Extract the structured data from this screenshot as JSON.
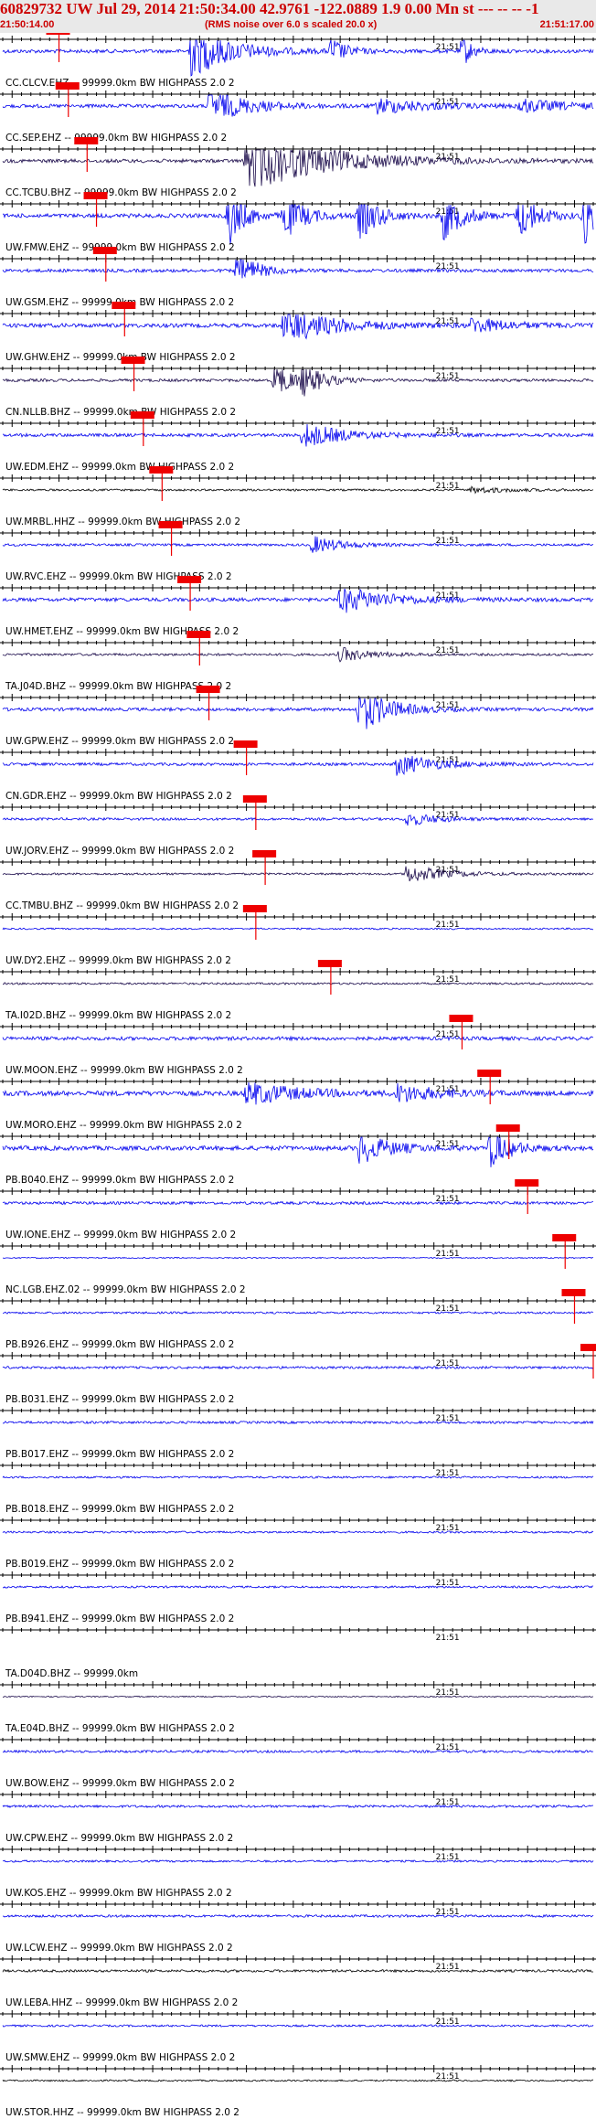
{
  "header": {
    "title": "60829732 UW Jul 29, 2014 21:50:34.00   42.9761 -122.0889  1.9 0.00 Mn st --- -- -- -1",
    "start_time": "21:50:14.00",
    "scale_note": "(RMS noise over 6.0 s scaled 20.0 x)",
    "end_time": "21:51:17.00"
  },
  "chart_data": {
    "type": "seismogram",
    "time_range": [
      "21:50:14.00",
      "21:51:17.00"
    ],
    "minute_mark_label": "21:51",
    "minute_mark_time": "21:51:00",
    "colors": {
      "trace_blue": "#0000ee",
      "trace_dark": "#1a0a4a",
      "trace_black": "#000000",
      "pick": "#ee0000",
      "text": "#000000"
    },
    "traces": [
      {
        "label": "CC.CLCV.EHZ -- 99999.0km BW  HIGHPASS  2.0  2",
        "color": "blue",
        "amp": 0.9,
        "pick": "21:50:20",
        "bursts": [
          [
            20,
            4,
            2.5
          ],
          [
            35,
            1.5,
            1.2
          ],
          [
            49,
            1,
            1.5
          ]
        ]
      },
      {
        "label": "CC.SEP.EHZ -- 99999.0km BW  HIGHPASS  2.0  2",
        "color": "blue",
        "amp": 0.9,
        "pick": "21:50:21",
        "bursts": [
          [
            22,
            4,
            1.5
          ],
          [
            40,
            5,
            0.7
          ],
          [
            55,
            5,
            0.6
          ]
        ]
      },
      {
        "label": "CC.TCBU.BHZ -- 99999.0km BW  HIGHPASS  2.0  2",
        "color": "dark",
        "amp": 0.9,
        "pick": "21:50:23",
        "bursts": [
          [
            26,
            8,
            2.8
          ]
        ]
      },
      {
        "label": "UW.FMW.EHZ -- 99999.0km BW  HIGHPASS  2.0  2",
        "color": "blue",
        "amp": 1.0,
        "pick": "21:50:24",
        "bursts": [
          [
            24,
            1.5,
            3
          ],
          [
            30,
            2,
            2
          ],
          [
            38,
            2,
            2
          ],
          [
            47,
            2,
            2
          ],
          [
            55,
            2,
            2
          ],
          [
            62,
            1.5,
            2.5
          ]
        ]
      },
      {
        "label": "UW.GSM.EHZ -- 99999.0km BW  HIGHPASS  2.0  2",
        "color": "blue",
        "amp": 0.8,
        "pick": "21:50:25",
        "bursts": [
          [
            25,
            2,
            2
          ]
        ]
      },
      {
        "label": "UW.GHW.EHZ -- 99999.0km BW  HIGHPASS  2.0  2",
        "color": "blue",
        "amp": 1.0,
        "pick": "21:50:27",
        "bursts": [
          [
            30,
            5,
            1.5
          ],
          [
            50,
            4,
            0.6
          ]
        ]
      },
      {
        "label": "CN.NLLB.BHZ -- 99999.0km BW  HIGHPASS  2.0  2",
        "color": "dark",
        "amp": 0.7,
        "pick": "21:50:28",
        "bursts": [
          [
            29,
            2,
            2.2
          ],
          [
            32,
            2,
            1.8
          ]
        ]
      },
      {
        "label": "UW.EDM.EHZ -- 99999.0km BW  HIGHPASS  2.0  2",
        "color": "blue",
        "amp": 0.8,
        "pick": "21:50:29",
        "bursts": [
          [
            32,
            4,
            1.3
          ]
        ]
      },
      {
        "label": "UW.MRBL.HHZ -- 99999.0km BW  HIGHPASS  2.0  2",
        "color": "black",
        "amp": 0.5,
        "pick": "21:50:31",
        "bursts": [
          [
            50,
            4,
            0.5
          ]
        ]
      },
      {
        "label": "UW.RVC.EHZ -- 99999.0km BW  HIGHPASS  2.0  2",
        "color": "blue",
        "amp": 0.6,
        "pick": "21:50:32",
        "bursts": [
          [
            33,
            3,
            1.2
          ]
        ]
      },
      {
        "label": "UW.HMET.EHZ -- 99999.0km BW  HIGHPASS  2.0  2",
        "color": "blue",
        "amp": 0.9,
        "pick": "21:50:34",
        "bursts": [
          [
            36,
            5,
            1.2
          ]
        ]
      },
      {
        "label": "TA.J04D.BHZ -- 99999.0km BW  HIGHPASS  2.0  2",
        "color": "dark",
        "amp": 0.6,
        "pick": "21:50:35",
        "bursts": [
          [
            36,
            3,
            1.0
          ]
        ]
      },
      {
        "label": "UW.GPW.EHZ -- 99999.0km BW  HIGHPASS  2.0  2",
        "color": "blue",
        "amp": 0.8,
        "pick": "21:50:36",
        "bursts": [
          [
            38,
            3,
            2.5
          ]
        ]
      },
      {
        "label": "CN.GDR.EHZ -- 99999.0km BW  HIGHPASS  2.0  2",
        "color": "blue",
        "amp": 0.7,
        "pick": "21:50:40",
        "bursts": [
          [
            42,
            4,
            1.3
          ]
        ]
      },
      {
        "label": "UW.JORV.EHZ -- 99999.0km BW  HIGHPASS  2.0  2",
        "color": "blue",
        "amp": 0.6,
        "pick": "21:50:41",
        "bursts": [
          [
            43,
            3,
            1.0
          ]
        ]
      },
      {
        "label": "CC.TMBU.BHZ -- 99999.0km BW  HIGHPASS  2.0  2",
        "color": "dark",
        "amp": 0.5,
        "pick": "21:50:42",
        "bursts": [
          [
            43,
            4,
            1.5
          ]
        ]
      },
      {
        "label": "UW.DY2.EHZ -- 99999.0km BW  HIGHPASS  2.0  2",
        "color": "blue",
        "amp": 0.4,
        "pick": "21:50:41",
        "bursts": []
      },
      {
        "label": "TA.I02D.BHZ -- 99999.0km BW  HIGHPASS  2.0  2",
        "color": "dark",
        "amp": 0.5,
        "pick": "21:50:49",
        "bursts": []
      },
      {
        "label": "UW.MOON.EHZ -- 99999.0km BW  HIGHPASS  2.0  2",
        "color": "blue",
        "amp": 0.9,
        "pick": "21:51:03",
        "bursts": [
          [
            75,
            4,
            1.2
          ]
        ]
      },
      {
        "label": "UW.MORO.EHZ -- 99999.0km BW  HIGHPASS  2.0  2",
        "color": "blue",
        "amp": 1.2,
        "pick": "21:51:06",
        "bursts": [
          [
            26,
            5,
            0.8
          ],
          [
            42,
            4,
            0.6
          ],
          [
            70,
            8,
            0.8
          ]
        ]
      },
      {
        "label": "PB.B040.EHZ -- 99999.0km BW  HIGHPASS  2.0  2",
        "color": "blue",
        "amp": 1.1,
        "pick": "21:51:08",
        "bursts": [
          [
            38,
            3,
            1.2
          ],
          [
            52,
            2,
            1.5
          ],
          [
            66,
            4,
            1.8
          ],
          [
            76,
            4,
            2.5
          ]
        ]
      },
      {
        "label": "UW.IONE.EHZ -- 99999.0km BW  HIGHPASS  2.0  2",
        "color": "blue",
        "amp": 0.7,
        "pick": "21:51:10",
        "bursts": [
          [
            78,
            3,
            2.5
          ]
        ]
      },
      {
        "label": "NC.LGB.EHZ.02 -- 99999.0km BW  HIGHPASS  2.0  2",
        "color": "blue",
        "amp": 0.3,
        "pick": "21:51:14",
        "bursts": []
      },
      {
        "label": "PB.B926.EHZ -- 99999.0km BW  HIGHPASS  2.0  2",
        "color": "blue",
        "amp": 0.5,
        "pick": "21:51:15",
        "bursts": []
      },
      {
        "label": "PB.B031.EHZ -- 99999.0km BW  HIGHPASS  2.0  2",
        "color": "blue",
        "amp": 0.6,
        "pick": "21:51:17",
        "bursts": [
          [
            85,
            3,
            1.5
          ]
        ]
      },
      {
        "label": "PB.B017.EHZ -- 99999.0km BW  HIGHPASS  2.0  2",
        "color": "blue",
        "amp": 0.6,
        "pick": null,
        "bursts": []
      },
      {
        "label": "PB.B018.EHZ -- 99999.0km BW  HIGHPASS  2.0  2",
        "color": "blue",
        "amp": 0.5,
        "pick": null,
        "bursts": []
      },
      {
        "label": "PB.B019.EHZ -- 99999.0km BW  HIGHPASS  2.0  2",
        "color": "blue",
        "amp": 0.5,
        "pick": null,
        "bursts": []
      },
      {
        "label": "PB.B941.EHZ -- 99999.0km BW  HIGHPASS  2.0  2",
        "color": "blue",
        "amp": 0.5,
        "pick": null,
        "bursts": []
      },
      {
        "label": "TA.D04D.BHZ -- 99999.0km",
        "color": "blue",
        "amp": 0.0,
        "pick": null,
        "bursts": []
      },
      {
        "label": "TA.E04D.BHZ -- 99999.0km BW  HIGHPASS  2.0  2",
        "color": "dark",
        "amp": 0.3,
        "pick": null,
        "bursts": []
      },
      {
        "label": "UW.BOW.EHZ -- 99999.0km BW  HIGHPASS  2.0  2",
        "color": "blue",
        "amp": 0.6,
        "pick": null,
        "bursts": []
      },
      {
        "label": "UW.CPW.EHZ -- 99999.0km BW  HIGHPASS  2.0  2",
        "color": "blue",
        "amp": 0.6,
        "pick": null,
        "bursts": []
      },
      {
        "label": "UW.KOS.EHZ -- 99999.0km BW  HIGHPASS  2.0  2",
        "color": "blue",
        "amp": 0.5,
        "pick": null,
        "bursts": []
      },
      {
        "label": "UW.LCW.EHZ -- 99999.0km BW  HIGHPASS  2.0  2",
        "color": "blue",
        "amp": 0.6,
        "pick": null,
        "bursts": []
      },
      {
        "label": "UW.LEBA.HHZ -- 99999.0km BW  HIGHPASS  2.0  2",
        "color": "black",
        "amp": 0.6,
        "pick": null,
        "bursts": []
      },
      {
        "label": "UW.SMW.EHZ -- 99999.0km BW  HIGHPASS  2.0  2",
        "color": "blue",
        "amp": 0.5,
        "pick": null,
        "bursts": []
      },
      {
        "label": "UW.STOR.HHZ -- 99999.0km BW  HIGHPASS  2.0  2",
        "color": "black",
        "amp": 0.4,
        "pick": null,
        "bursts": []
      }
    ]
  }
}
